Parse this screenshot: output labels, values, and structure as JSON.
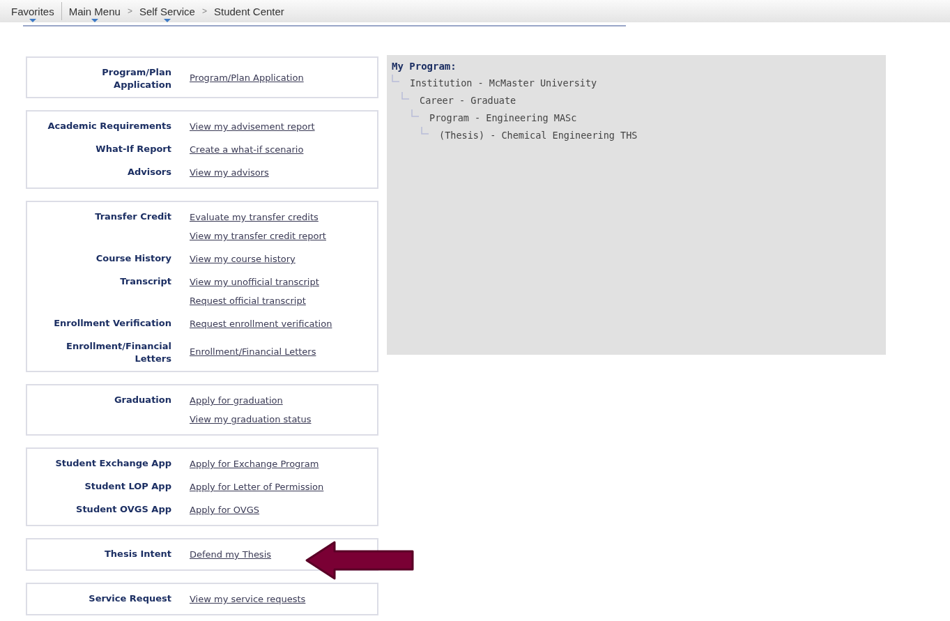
{
  "nav": {
    "favorites": {
      "label": "Favorites",
      "has_menu": true
    },
    "separator": ">",
    "path": [
      {
        "label": "Main Menu",
        "has_menu": true
      },
      {
        "label": "Self Service",
        "has_menu": true
      },
      {
        "label": "Student Center",
        "has_menu": false
      }
    ]
  },
  "sections": [
    {
      "rows": [
        {
          "label": "Program/Plan\nApplication",
          "links": [
            "Program/Plan Application"
          ]
        }
      ]
    },
    {
      "rows": [
        {
          "label": "Academic Requirements",
          "links": [
            "View my advisement report"
          ]
        },
        {
          "label": "What-If Report",
          "links": [
            "Create a what-if scenario"
          ]
        },
        {
          "label": "Advisors",
          "links": [
            "View my advisors"
          ]
        }
      ]
    },
    {
      "rows": [
        {
          "label": "Transfer Credit",
          "links": [
            "Evaluate my transfer credits",
            "View my transfer credit report"
          ]
        },
        {
          "label": "Course History",
          "links": [
            "View my course history"
          ]
        },
        {
          "label": "Transcript",
          "links": [
            "View my unofficial transcript",
            "Request official transcript"
          ]
        },
        {
          "label": "Enrollment Verification",
          "links": [
            "Request enrollment verification"
          ]
        },
        {
          "label": "Enrollment/Financial\nLetters",
          "links": [
            "Enrollment/Financial Letters"
          ]
        }
      ]
    },
    {
      "rows": [
        {
          "label": "Graduation",
          "links": [
            "Apply for graduation",
            "View my graduation status"
          ]
        }
      ]
    },
    {
      "rows": [
        {
          "label": "Student Exchange App",
          "links": [
            "Apply for Exchange Program"
          ]
        },
        {
          "label": "Student LOP App",
          "links": [
            "Apply for Letter of Permission"
          ]
        },
        {
          "label": "Student OVGS App",
          "links": [
            "Apply for OVGS"
          ]
        }
      ]
    },
    {
      "rows": [
        {
          "label": "Thesis Intent",
          "links": [
            "Defend my Thesis"
          ]
        }
      ]
    },
    {
      "rows": [
        {
          "label": "Service Request",
          "links": [
            "View my service requests"
          ]
        }
      ]
    }
  ],
  "program": {
    "title": "My Program:",
    "tree": [
      {
        "label": "Institution - McMaster University",
        "children": [
          {
            "label": "Career - Graduate",
            "children": [
              {
                "label": "Program - Engineering MASc",
                "children": [
                  {
                    "label": "(Thesis) - Chemical Engineering THS"
                  }
                ]
              }
            ]
          }
        ]
      }
    ]
  }
}
